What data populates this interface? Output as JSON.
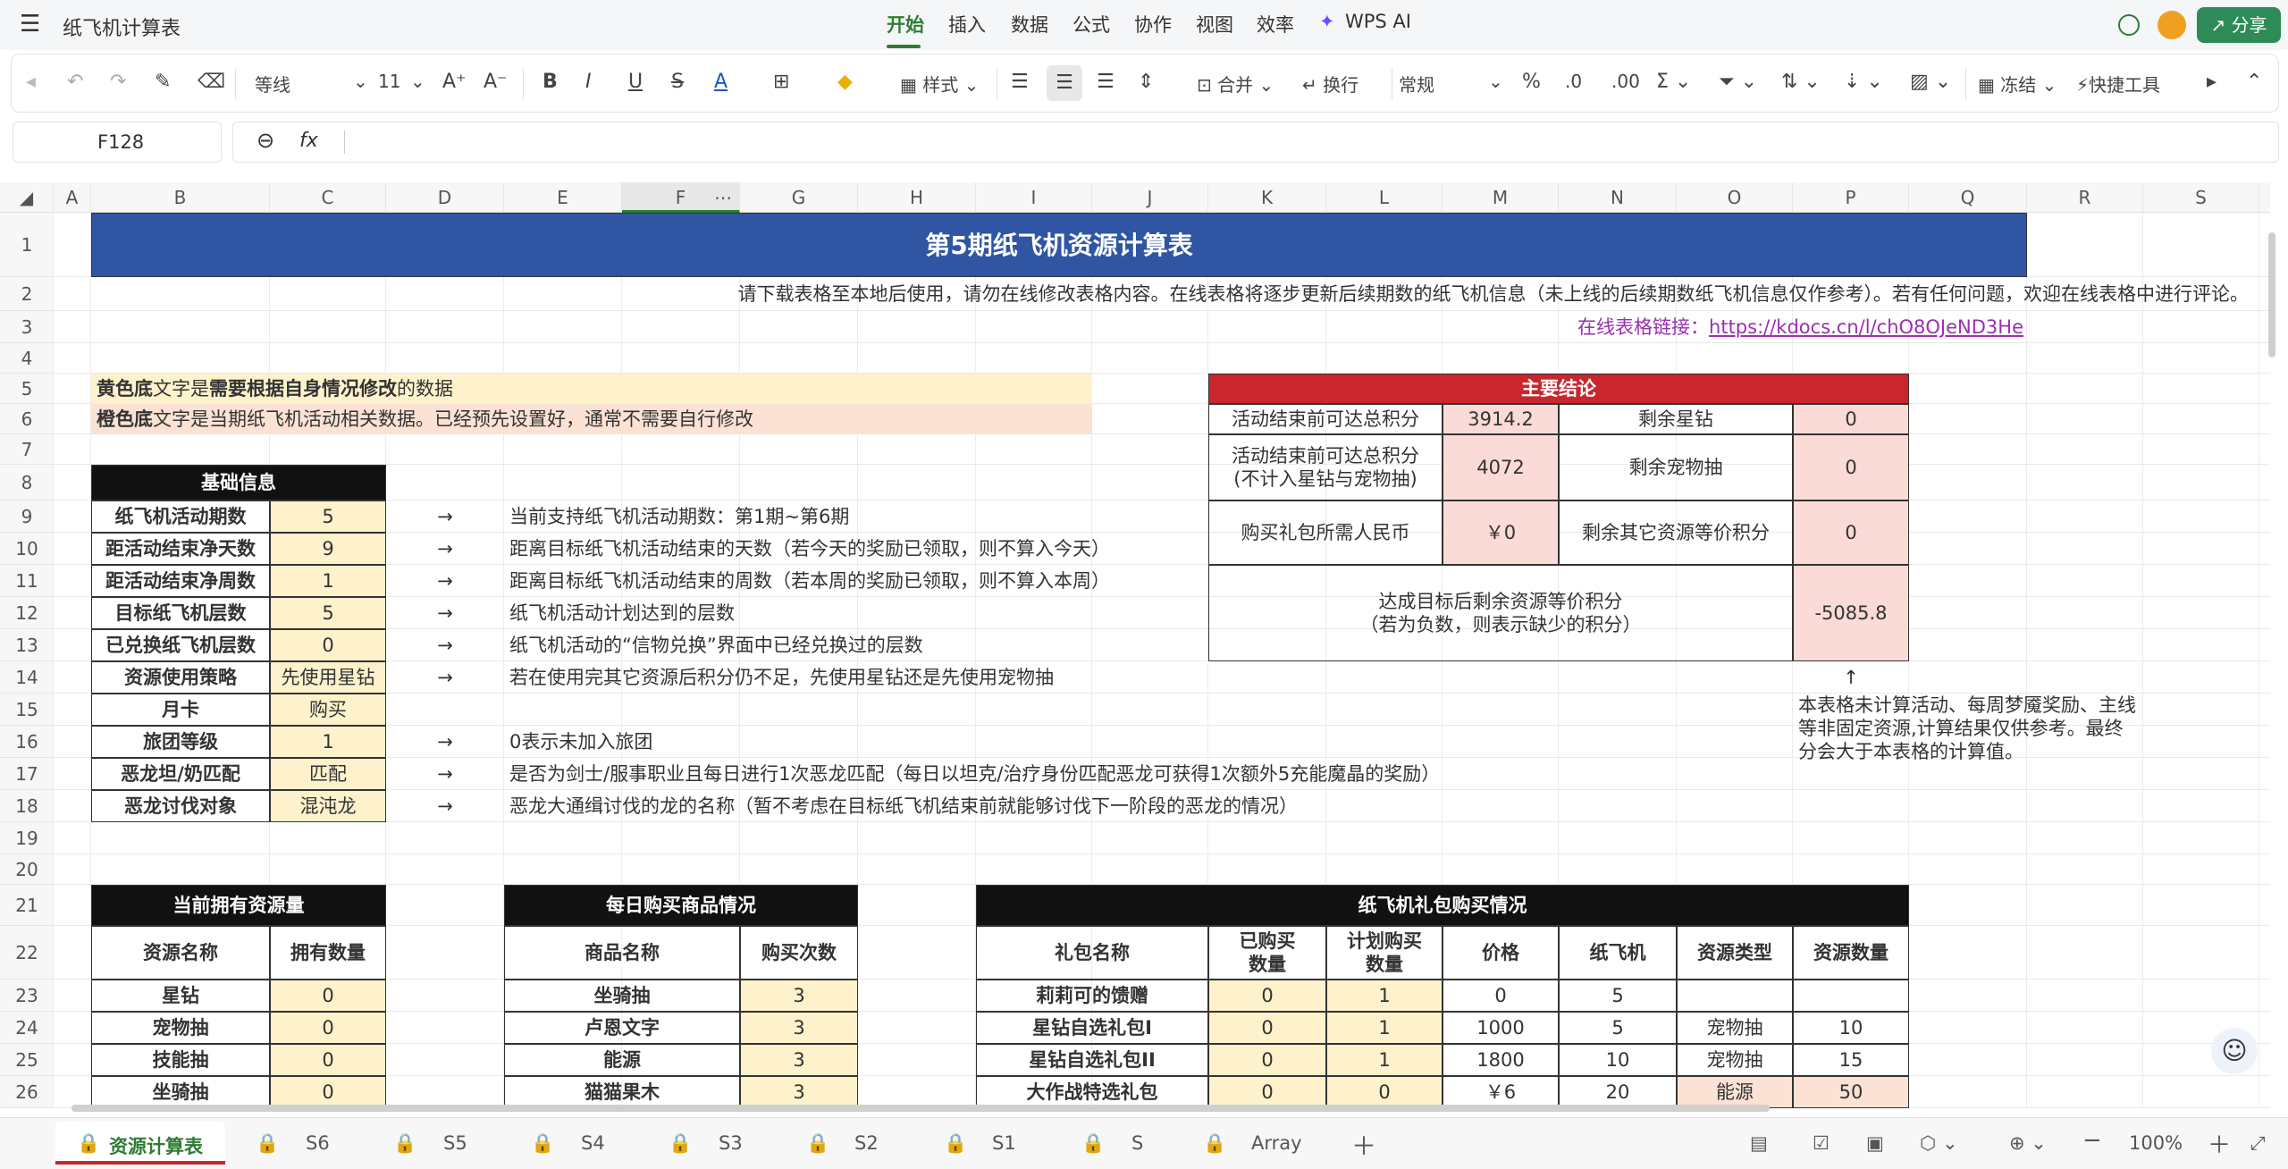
{
  "app": {
    "doc_title": "纸飞机计算表",
    "menus": [
      "开始",
      "插入",
      "数据",
      "公式",
      "协作",
      "视图",
      "效率",
      "WPS AI"
    ],
    "share": "分享"
  },
  "toolbar": {
    "font": "等线",
    "size": "11",
    "style": "样式",
    "merge": "合并",
    "wrap": "换行",
    "format": "常规",
    "freeze": "冻结",
    "quick": "快捷工具"
  },
  "formula": {
    "cell_ref": "F128",
    "fx": "fx",
    "value": ""
  },
  "columns": [
    "A",
    "B",
    "C",
    "D",
    "E",
    "F",
    "G",
    "H",
    "I",
    "J",
    "K",
    "L",
    "M",
    "N",
    "O",
    "P",
    "Q",
    "R",
    "S"
  ],
  "rows": [
    "1",
    "2",
    "3",
    "4",
    "5",
    "6",
    "7",
    "8",
    "9",
    "10",
    "11",
    "12",
    "13",
    "14",
    "15",
    "16",
    "17",
    "18",
    "19",
    "20",
    "21",
    "22",
    "23",
    "24",
    "25",
    "26"
  ],
  "sheet": {
    "banner": "第5期纸飞机资源计算表",
    "intro": "请下载表格至本地后使用，请勿在线修改表格内容。在线表格将逐步更新后续期数的纸飞机信息（未上线的后续期数纸飞机信息仅作参考）。若有任何问题，欢迎在线表格中进行评论。",
    "link_label": "在线表格链接：",
    "link_url": "https://kdocs.cn/l/chO8OJeND3He",
    "legend_yellow_a": "黄色底",
    "legend_yellow_b": "文字是",
    "legend_yellow_c": "需要根据自身情况修改",
    "legend_yellow_d": "的数据",
    "legend_orange_a": "橙色底",
    "legend_orange_b": "文字是当期纸飞机活动相关数据。已经预先设置好，通常不需要自行修改",
    "basic_header": "基础信息",
    "basic": [
      {
        "label": "纸飞机活动期数",
        "value": "5",
        "arrow": "→",
        "note": "当前支持纸飞机活动期数：第1期~第6期"
      },
      {
        "label": "距活动结束净天数",
        "value": "9",
        "arrow": "→",
        "note": "距离目标纸飞机活动结束的天数（若今天的奖励已领取，则不算入今天）"
      },
      {
        "label": "距活动结束净周数",
        "value": "1",
        "arrow": "→",
        "note": "距离目标纸飞机活动结束的周数（若本周的奖励已领取，则不算入本周）"
      },
      {
        "label": "目标纸飞机层数",
        "value": "5",
        "arrow": "→",
        "note": "纸飞机活动计划达到的层数"
      },
      {
        "label": "已兑换纸飞机层数",
        "value": "0",
        "arrow": "→",
        "note": "纸飞机活动的“信物兑换”界面中已经兑换过的层数"
      },
      {
        "label": "资源使用策略",
        "value": "先使用星钻",
        "arrow": "→",
        "note": "若在使用完其它资源后积分仍不足，先使用星钻还是先使用宠物抽"
      },
      {
        "label": "月卡",
        "value": "购买",
        "arrow": "",
        "note": ""
      },
      {
        "label": "旅团等级",
        "value": "1",
        "arrow": "→",
        "note": "0表示未加入旅团"
      },
      {
        "label": "恶龙坦/奶匹配",
        "value": "匹配",
        "arrow": "→",
        "note": "是否为剑士/服事职业且每日进行1次恶龙匹配（每日以坦克/治疗身份匹配恶龙可获得1次额外5充能魔晶的奖励）"
      },
      {
        "label": "恶龙讨伐对象",
        "value": "混沌龙",
        "arrow": "→",
        "note": "恶龙大通缉讨伐的龙的名称（暂不考虑在目标纸飞机结束前就能够讨伐下一阶段的恶龙的情况）"
      }
    ],
    "main_header": "主要结论",
    "main": {
      "r1_label": "活动结束前可达总积分",
      "r1_value": "3914.2",
      "r1_label2": "剩余星钻",
      "r1_value2": "0",
      "r2_label": "活动结束前可达总积分",
      "r2_label_b": "(不计入星钻与宠物抽)",
      "r2_value": "4072",
      "r2_label2": "剩余宠物抽",
      "r2_value2": "0",
      "r3_label": "购买礼包所需人民币",
      "r3_value": "￥0",
      "r3_label2": "剩余其它资源等价积分",
      "r3_value2": "0",
      "r4_label": "达成目标后剩余资源等价积分",
      "r4_label_b": "（若为负数，则表示缺少的积分）",
      "r4_value": "-5085.8"
    },
    "up_arrow": "↑",
    "side_note": [
      "本表格未计算活动、每周梦魇奖励、主线",
      "等非固定资源,计算结果仅供参考。最终",
      "分会大于本表格的计算值。"
    ],
    "owned_header": "当前拥有资源量",
    "owned_cols": [
      "资源名称",
      "拥有数量"
    ],
    "owned": [
      [
        "星钻",
        "0"
      ],
      [
        "宠物抽",
        "0"
      ],
      [
        "技能抽",
        "0"
      ],
      [
        "坐骑抽",
        "0"
      ]
    ],
    "daily_header": "每日购买商品情况",
    "daily_cols": [
      "商品名称",
      "购买次数"
    ],
    "daily": [
      [
        "坐骑抽",
        "3"
      ],
      [
        "卢恩文字",
        "3"
      ],
      [
        "能源",
        "3"
      ],
      [
        "猫猫果木",
        "3"
      ]
    ],
    "gift_header": "纸飞机礼包购买情况",
    "gift_cols": [
      "礼包名称",
      "已购买\n数量",
      "计划购买\n数量",
      "价格",
      "纸飞机",
      "资源类型",
      "资源数量"
    ],
    "gift": [
      [
        "莉莉可的馈赠",
        "0",
        "1",
        "0",
        "5",
        "",
        ""
      ],
      [
        "星钻自选礼包I",
        "0",
        "1",
        "1000",
        "5",
        "宠物抽",
        "10"
      ],
      [
        "星钻自选礼包II",
        "0",
        "1",
        "1800",
        "10",
        "宠物抽",
        "15"
      ],
      [
        "大作战特选礼包",
        "0",
        "0",
        "￥6",
        "20",
        "能源",
        "50"
      ]
    ]
  },
  "tabs": [
    "资源计算表",
    "S6",
    "S5",
    "S4",
    "S3",
    "S2",
    "S1",
    "S",
    "Array"
  ],
  "zoom": "100%"
}
